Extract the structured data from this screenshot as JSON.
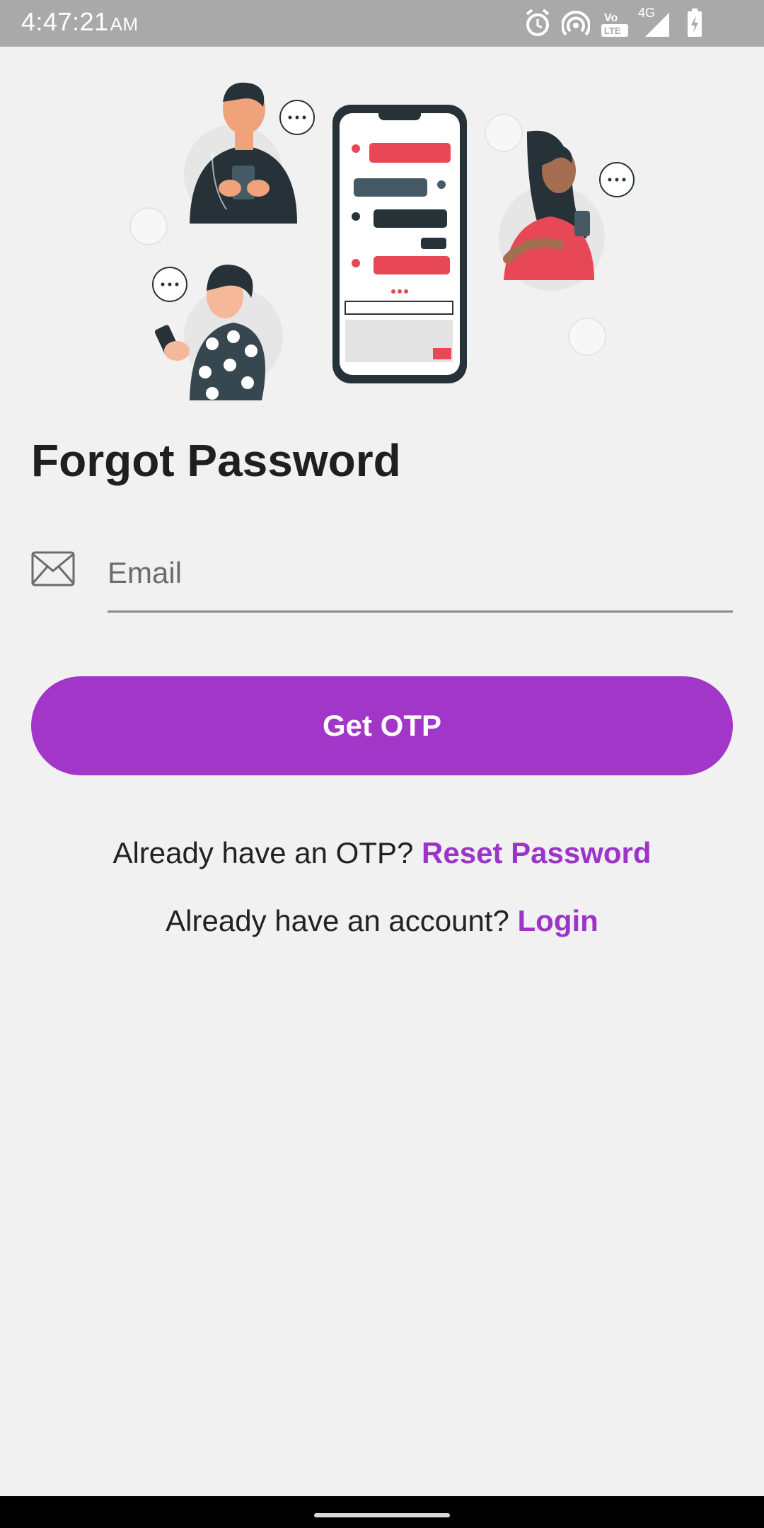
{
  "status_bar": {
    "time": "4:47:21",
    "ampm": "AM",
    "network": "4G",
    "volte": "Vo LTE",
    "icons": [
      "alarm-icon",
      "hotspot-icon",
      "volte-icon",
      "signal-icon",
      "battery-charging-icon"
    ]
  },
  "hero": {
    "illustration": "people-chatting-illustration"
  },
  "title": "Forgot Password",
  "email": {
    "placeholder": "Email",
    "value": "",
    "icon": "envelope-icon"
  },
  "otp_button": {
    "label": "Get OTP"
  },
  "links": {
    "otp_prompt": "Already have an OTP?",
    "reset_label": "Reset Password",
    "account_prompt": "Already have an account?",
    "login_label": "Login"
  },
  "colors": {
    "accent": "#a136c9",
    "background": "#f1f1f1",
    "status_bar": "#a9a9a9",
    "chat_red": "#e84855",
    "dark": "#263238"
  }
}
